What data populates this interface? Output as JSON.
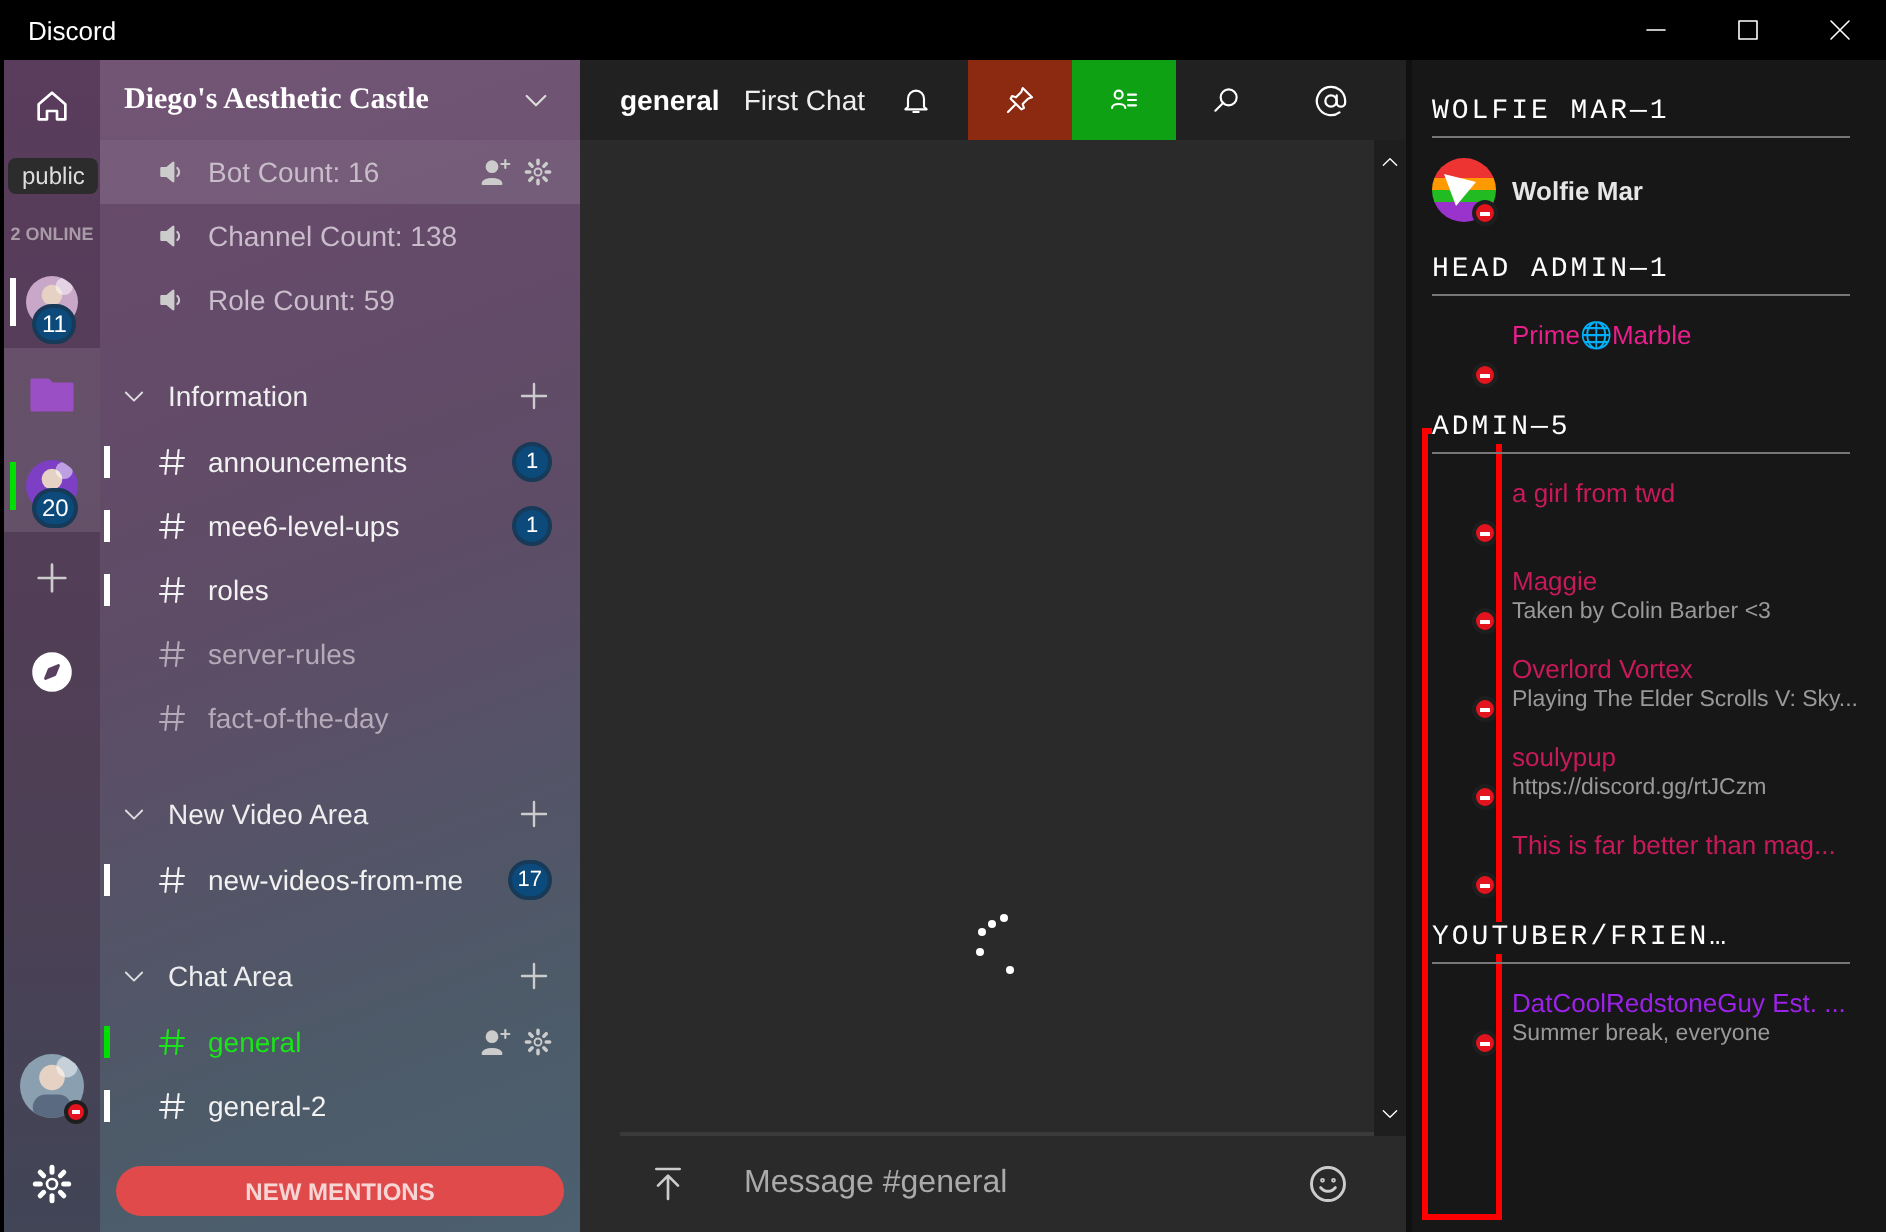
{
  "window": {
    "title": "Discord"
  },
  "rail": {
    "tooltip": "public",
    "online": "2 ONLINE",
    "servers": [
      {
        "kind": "server",
        "badge": "11",
        "unread": true,
        "selected": false
      },
      {
        "kind": "folder"
      },
      {
        "kind": "server",
        "badge": "20",
        "selected": true
      }
    ]
  },
  "server": {
    "name": "Diego's Aesthetic Castle"
  },
  "channels": [
    {
      "kind": "voice",
      "name": "Bot Count: 16",
      "hovered": true
    },
    {
      "kind": "voice",
      "name": "Channel Count: 138",
      "hovered": false
    },
    {
      "kind": "voice",
      "name": "Role Count: 59",
      "hovered": false
    },
    {
      "kind": "category",
      "name": "Information"
    },
    {
      "kind": "text",
      "name": "announcements",
      "unread": true,
      "selected": false,
      "badge": "1"
    },
    {
      "kind": "text",
      "name": "mee6-level-ups",
      "unread": true,
      "selected": false,
      "badge": "1"
    },
    {
      "kind": "text",
      "name": "roles",
      "unread": true,
      "selected": false
    },
    {
      "kind": "text",
      "name": "server-rules",
      "unread": false,
      "selected": false
    },
    {
      "kind": "text",
      "name": "fact-of-the-day",
      "unread": false,
      "selected": false
    },
    {
      "kind": "category",
      "name": "New Video Area"
    },
    {
      "kind": "text",
      "name": "new-videos-from-me",
      "unread": true,
      "selected": false,
      "badge": "17"
    },
    {
      "kind": "category",
      "name": "Chat Area"
    },
    {
      "kind": "text",
      "name": "general",
      "selected": true
    },
    {
      "kind": "text",
      "name": "general-2",
      "unread": true,
      "selected": false
    }
  ],
  "new_mentions": "NEW MENTIONS",
  "header": {
    "channel": "general",
    "topic": "First Chat"
  },
  "composer": {
    "placeholder": "Message #general"
  },
  "members": {
    "highlight_box": true,
    "groups": [
      {
        "title": "WOLFIE MAR—1",
        "members": [
          {
            "name": "Wolfie Mar",
            "color": "#e6e6e6",
            "avatar": true
          }
        ]
      },
      {
        "title": "HEAD ADMIN—1",
        "members": [
          {
            "name": "Prime🌐Marble",
            "color": "#e91e8c",
            "avatar": false
          }
        ]
      },
      {
        "title": "ADMIN—5",
        "members": [
          {
            "name": "a girl from twd",
            "color": "#c8195a",
            "avatar": false
          },
          {
            "name": "Maggie",
            "activity": "Taken by Colin Barber <3",
            "color": "#c8195a",
            "avatar": false
          },
          {
            "name": "Overlord Vortex",
            "activity": "Playing The Elder Scrolls V: Sky...",
            "color": "#c8195a",
            "avatar": false
          },
          {
            "name": "soulypup",
            "activity": "https://discord.gg/rtJCzm",
            "color": "#c8195a",
            "avatar": false
          },
          {
            "name": "This is far better than mag...",
            "color": "#c8195a",
            "avatar": false
          }
        ]
      },
      {
        "title": "YOUTUBER/FRIEN…",
        "members": [
          {
            "name": "DatCoolRedstoneGuy Est. ...",
            "activity": "Summer break, everyone",
            "color": "#9b22e8",
            "avatar": false
          }
        ]
      }
    ]
  }
}
